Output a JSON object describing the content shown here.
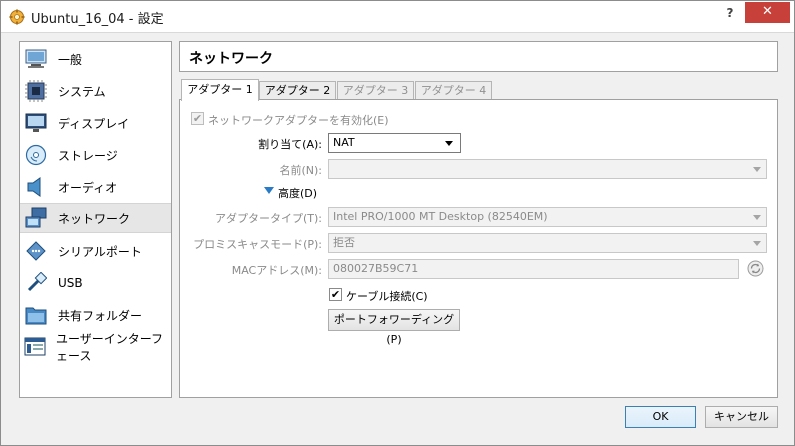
{
  "window": {
    "title": "Ubuntu_16_04 - 設定",
    "help_label": "?",
    "close_label": "✕"
  },
  "sidebar": {
    "items": [
      {
        "label": "一般",
        "icon": "monitor-icon"
      },
      {
        "label": "システム",
        "icon": "chip-icon"
      },
      {
        "label": "ディスプレイ",
        "icon": "display-icon"
      },
      {
        "label": "ストレージ",
        "icon": "storage-disc-icon"
      },
      {
        "label": "オーディオ",
        "icon": "speaker-icon"
      },
      {
        "label": "ネットワーク",
        "icon": "network-icon"
      },
      {
        "label": "シリアルポート",
        "icon": "serial-port-icon"
      },
      {
        "label": "USB",
        "icon": "usb-icon"
      },
      {
        "label": "共有フォルダー",
        "icon": "folder-icon"
      },
      {
        "label": "ユーザーインターフェース",
        "icon": "user-interface-icon"
      }
    ],
    "selected_index": 5
  },
  "main": {
    "title": "ネットワーク",
    "tabs": [
      {
        "label": "アダプター 1",
        "state": "active"
      },
      {
        "label": "アダプター 2",
        "state": "normal"
      },
      {
        "label": "アダプター 3",
        "state": "disabled"
      },
      {
        "label": "アダプター 4",
        "state": "disabled"
      }
    ],
    "enable_adapter": {
      "label": "ネットワークアダプターを有効化(E)",
      "checked": true,
      "disabled": true
    },
    "attached_to": {
      "label": "割り当て(A):",
      "value": "NAT"
    },
    "name": {
      "label": "名前(N):",
      "value": ""
    },
    "advanced_label": "高度(D)",
    "adapter_type": {
      "label": "アダプタータイプ(T):",
      "value": "Intel PRO/1000 MT Desktop (82540EM)"
    },
    "promiscuous": {
      "label": "プロミスキャスモード(P):",
      "value": "拒否"
    },
    "mac": {
      "label": "MACアドレス(M):",
      "value": "080027B59C71"
    },
    "cable_connected": {
      "label": "ケーブル接続(C)",
      "checked": true
    },
    "port_forwarding_label": "ポートフォワーディング(P)"
  },
  "footer": {
    "ok_label": "OK",
    "cancel_label": "キャンセル"
  },
  "colors": {
    "close_button": "#c7403a",
    "selection": "#e6e6e6",
    "default_button_border": "#3c7fb1",
    "disclosure_arrow": "#2a7bc5"
  }
}
